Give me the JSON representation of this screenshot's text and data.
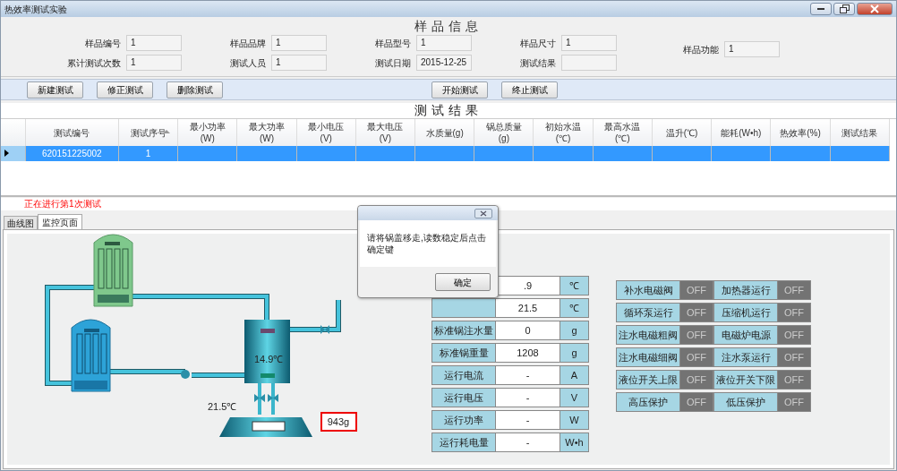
{
  "window": {
    "title": "热效率测试实验"
  },
  "sample_info": {
    "title": "样品信息",
    "columns": [
      [
        {
          "label": "样品编号",
          "value": "1"
        },
        {
          "label": "累计测试次数",
          "value": "1"
        }
      ],
      [
        {
          "label": "样品品牌",
          "value": "1"
        },
        {
          "label": "测试人员",
          "value": "1"
        }
      ],
      [
        {
          "label": "样品型号",
          "value": "1"
        },
        {
          "label": "测试日期",
          "value": "2015-12-25"
        }
      ],
      [
        {
          "label": "样品尺寸",
          "value": "1"
        },
        {
          "label": "测试结果"
        }
      ],
      [
        {
          "label": "样品功能",
          "value": "1"
        }
      ]
    ]
  },
  "toolbar": [
    [
      "新建测试",
      "修正测试",
      "删除测试"
    ],
    [
      "开始测试",
      "终止测试"
    ]
  ],
  "results": {
    "title": "测试结果",
    "columns": [
      {
        "label": "测试编号",
        "sorted": false
      },
      {
        "label": "测试序号",
        "sorted": true
      },
      {
        "label": "最小功率",
        "unit": "(W)",
        "sorted": false
      },
      {
        "label": "最大功率",
        "unit": "(W)",
        "sorted": false
      },
      {
        "label": "最小电压",
        "unit": "(V)",
        "sorted": false
      },
      {
        "label": "最大电压",
        "unit": "(V)",
        "sorted": false
      },
      {
        "label": "水质量(g)",
        "sorted": false
      },
      {
        "label": "锅总质量",
        "unit": "(g)",
        "sorted": false
      },
      {
        "label": "初始水温",
        "unit": "(℃)",
        "sorted": false
      },
      {
        "label": "最高水温",
        "unit": "(℃)",
        "sorted": false
      },
      {
        "label": "温升(℃)",
        "sorted": false
      },
      {
        "label": "能耗(W•h)",
        "sorted": false
      },
      {
        "label": "热效率(%)",
        "sorted": false
      },
      {
        "label": "测试结果",
        "sorted": false
      }
    ],
    "rows": [
      {
        "selected": true,
        "cells": [
          "620151225002",
          "1"
        ]
      }
    ]
  },
  "status": "正在进行第1次测试",
  "tabs": [
    {
      "label": "曲线图",
      "selected": false
    },
    {
      "label": "监控页面",
      "selected": true
    }
  ],
  "diagram": {
    "tank_temperature": "14.9℃",
    "water_temperature": "21.5℃",
    "scale_reading": "943g"
  },
  "readouts": [
    {
      "value": ".9",
      "unit": "℃"
    },
    {
      "value": "21.5",
      "unit": "℃"
    },
    {
      "label": "标准锅注水量",
      "value": "0",
      "unit": "g"
    },
    {
      "label": "标准锅重量",
      "value": "1208",
      "unit": "g"
    },
    {
      "label": "运行电流",
      "value": "-",
      "unit": "A"
    },
    {
      "label": "运行电压",
      "value": "-",
      "unit": "V"
    },
    {
      "label": "运行功率",
      "value": "-",
      "unit": "W"
    },
    {
      "label": "运行耗电量",
      "value": "-",
      "unit": "W•h"
    }
  ],
  "switches": [
    {
      "label": "补水电磁阀",
      "state": "OFF",
      "on": false
    },
    {
      "label": "加热器运行",
      "state": "OFF",
      "on": false
    },
    {
      "label": "循环泵运行",
      "state": "OFF",
      "on": false
    },
    {
      "label": "压缩机运行",
      "state": "OFF",
      "on": false
    },
    {
      "label": "注水电磁粗阀",
      "state": "OFF",
      "on": false
    },
    {
      "label": "电磁炉电源",
      "state": "OFF",
      "on": false
    },
    {
      "label": "注水电磁细阀",
      "state": "OFF",
      "on": false
    },
    {
      "label": "注水泵运行",
      "state": "OFF",
      "on": false
    },
    {
      "label": "液位开关上限",
      "state": "OFF",
      "on": false
    },
    {
      "label": "液位开关下限",
      "state": "OFF",
      "on": false
    },
    {
      "label": "高压保护",
      "state": "OFF",
      "on": false
    },
    {
      "label": "低压保护",
      "state": "OFF",
      "on": false
    }
  ],
  "dialog": {
    "message": "请将锅盖移走,读数稳定后点击确定键",
    "button": "确定"
  }
}
